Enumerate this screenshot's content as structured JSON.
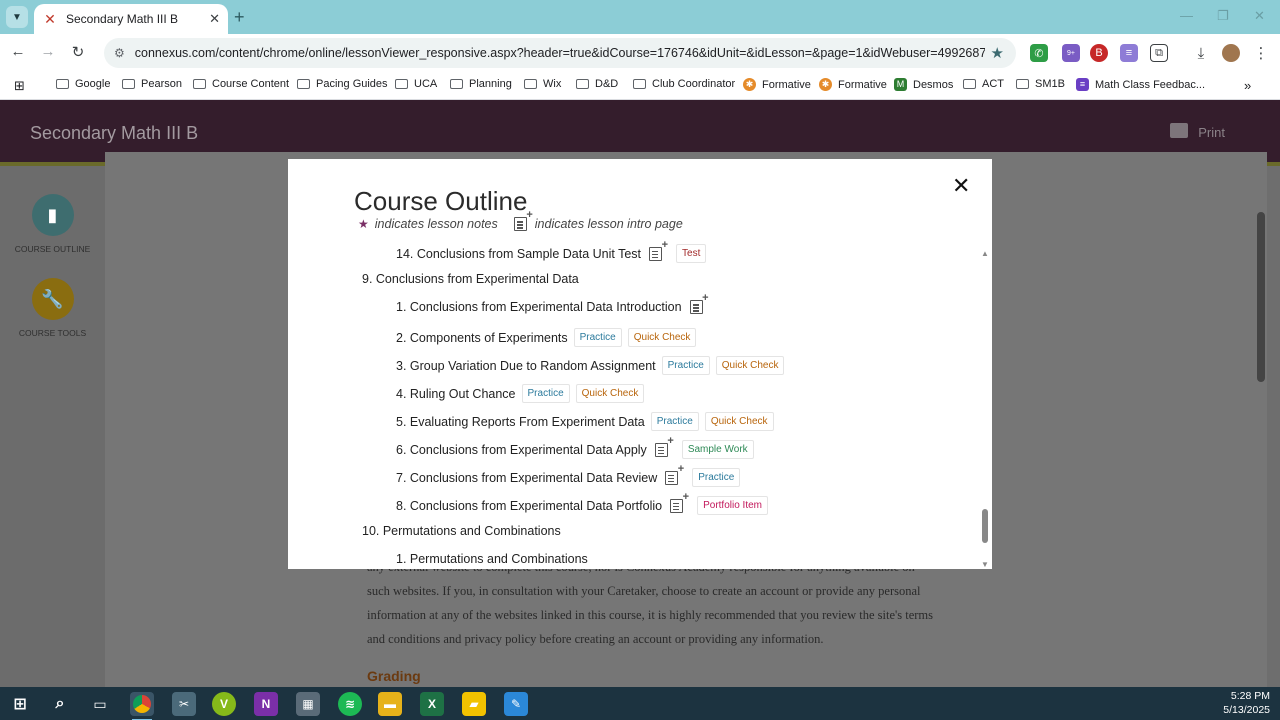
{
  "browser": {
    "tab_title": "Secondary Math III B",
    "url": "connexus.com/content/chrome/online/lessonViewer_responsive.aspx?header=true&idCourse=176746&idUnit=&idLesson=&page=1&idWebuser=4992687&idSec...",
    "bookmarks": [
      "Google",
      "Pearson",
      "Course Content",
      "Pacing Guides",
      "UCA",
      "Planning",
      "Wix",
      "D&D",
      "Club Coordinator",
      "Formative",
      "Formative",
      "Desmos",
      "ACT",
      "SM1B",
      "Math Class Feedbac..."
    ],
    "ext_badge": "9+"
  },
  "page": {
    "title": "Secondary Math III B",
    "print_label": "Print",
    "side": {
      "outline_label": "COURSE OUTLINE",
      "tools_label": "COURSE TOOLS"
    },
    "body_lines": [
      "any external website to complete this course, nor is Connexus Academy responsible for anything available on",
      "such websites. If you, in consultation with your Caretaker, choose to create an account or provide any personal",
      "information at any of the websites linked in this course, it is highly recommended that you review the site's terms",
      "and conditions and privacy policy before creating an account or providing any information."
    ],
    "grading_heading": "Grading"
  },
  "modal": {
    "title": "Course Outline",
    "legend_notes": "indicates lesson notes",
    "legend_intro": "indicates lesson intro page",
    "rows": [
      {
        "level": "lesson",
        "text": "14. Conclusions from Sample Data Unit Test",
        "note": true,
        "badges": [
          {
            "label": "Test",
            "kind": "test"
          }
        ]
      },
      {
        "level": "unit",
        "text": "9. Conclusions from Experimental Data",
        "note": false,
        "badges": []
      },
      {
        "level": "lesson",
        "text": "1. Conclusions from Experimental Data Introduction",
        "note": true,
        "badges": []
      },
      {
        "level": "lesson",
        "text": "2. Components of Experiments",
        "note": false,
        "badges": [
          {
            "label": "Practice",
            "kind": "practice"
          },
          {
            "label": "Quick Check",
            "kind": "quick"
          }
        ]
      },
      {
        "level": "lesson",
        "text": "3. Group Variation Due to Random Assignment",
        "note": false,
        "badges": [
          {
            "label": "Practice",
            "kind": "practice"
          },
          {
            "label": "Quick Check",
            "kind": "quick"
          }
        ]
      },
      {
        "level": "lesson",
        "text": "4. Ruling Out Chance",
        "note": false,
        "badges": [
          {
            "label": "Practice",
            "kind": "practice"
          },
          {
            "label": "Quick Check",
            "kind": "quick"
          }
        ]
      },
      {
        "level": "lesson",
        "text": "5. Evaluating Reports From Experiment Data",
        "note": false,
        "badges": [
          {
            "label": "Practice",
            "kind": "practice"
          },
          {
            "label": "Quick Check",
            "kind": "quick"
          }
        ]
      },
      {
        "level": "lesson",
        "text": "6. Conclusions from Experimental Data Apply",
        "note": true,
        "badges": [
          {
            "label": "Sample Work",
            "kind": "sample"
          }
        ]
      },
      {
        "level": "lesson",
        "text": "7. Conclusions from Experimental Data Review",
        "note": true,
        "badges": [
          {
            "label": "Practice",
            "kind": "practice"
          }
        ]
      },
      {
        "level": "lesson",
        "text": "8. Conclusions from Experimental Data Portfolio",
        "note": true,
        "badges": [
          {
            "label": "Portfolio Item",
            "kind": "portfolio"
          }
        ]
      },
      {
        "level": "unit",
        "text": "10. Permutations and Combinations",
        "note": false,
        "badges": []
      },
      {
        "level": "lesson",
        "text": "1. Permutations and Combinations",
        "note": false,
        "badges": []
      }
    ]
  },
  "taskbar": {
    "time": "5:28 PM",
    "date": "5/13/2025"
  },
  "colors": {
    "header": "#341d2c",
    "accent_star": "#7a2f66",
    "tabstrip": "#8ccdd6"
  }
}
